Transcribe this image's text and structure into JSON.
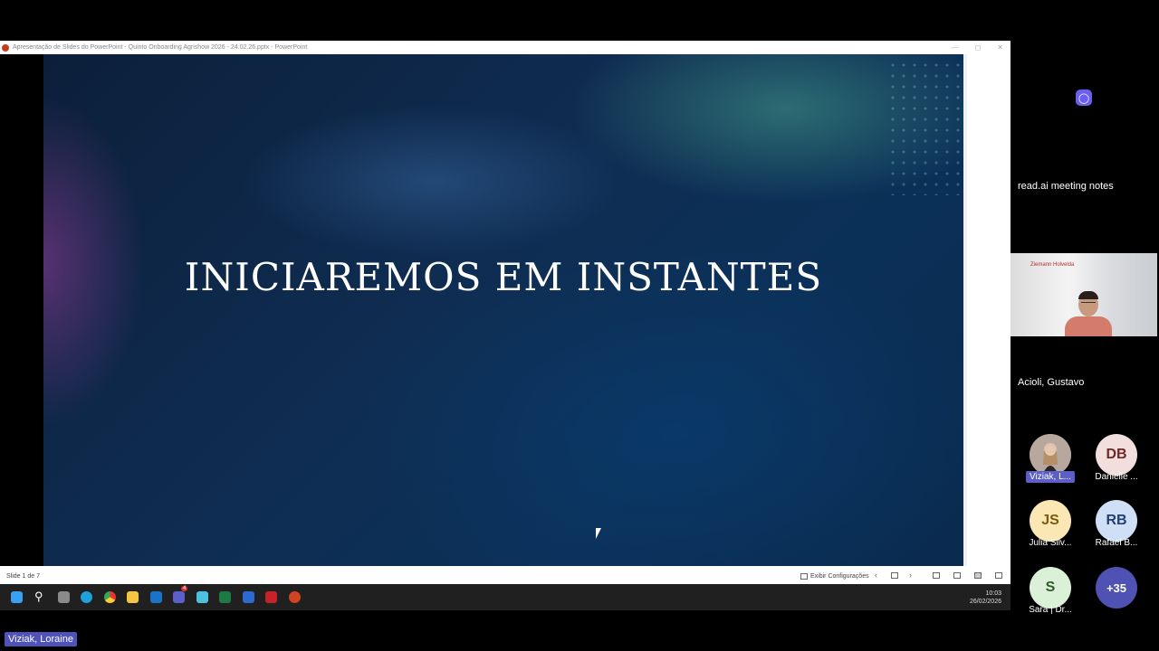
{
  "powerpoint": {
    "window_title": "Apresentação de Slides do PowerPoint  -  Quinto Onboarding Agrishow 2026 - 24.02.26.pptx - PowerPoint",
    "slide_title": "INICIAREMOS EM INSTANTES",
    "status": {
      "slide_counter": "Slide 1 de 7",
      "display_settings_label": "Exibir Configurações"
    }
  },
  "taskbar": {
    "time": "10:03",
    "date": "26/02/2026",
    "apps": [
      "windows-start",
      "search",
      "task-view",
      "edge",
      "chrome",
      "file-explorer",
      "outlook",
      "teams",
      "notepad",
      "excel",
      "word",
      "acrobat",
      "powerpoint"
    ],
    "teams_badge": "4"
  },
  "meeting": {
    "readai_label": "read.ai meeting notes",
    "video_participant": "Acioli, Gustavo",
    "video_logo_text": "Ziemann Holvelda",
    "participants": [
      {
        "initials": "",
        "name": "Viziak, L...",
        "color": "#8a7a72"
      },
      {
        "initials": "DB",
        "name": "Danielle ...",
        "color": "#f2dedc"
      },
      {
        "initials": "JS",
        "name": "Julia Silv...",
        "color": "#fbe7b4"
      },
      {
        "initials": "RB",
        "name": "Rafael B...",
        "color": "#cfe0f6"
      },
      {
        "initials": "S",
        "name": "Sara | Dr...",
        "color": "#dbf1d7"
      },
      {
        "initials": "+35",
        "name": "",
        "color": "#4f52b2"
      }
    ],
    "self_name": "Viziak, Loraine"
  }
}
